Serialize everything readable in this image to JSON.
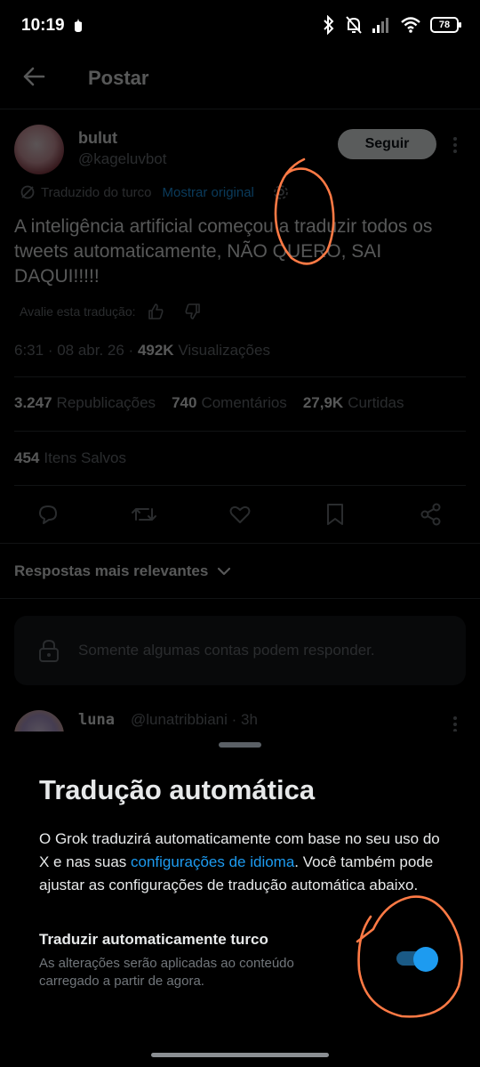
{
  "status_bar": {
    "time": "10:19",
    "battery": "78",
    "icons": [
      "notification-dot-icon",
      "bluetooth-icon",
      "mute-icon",
      "signal-icon",
      "wifi-icon",
      "battery-icon"
    ]
  },
  "header": {
    "title": "Postar",
    "back_icon": "arrow-left-icon"
  },
  "post": {
    "author_name": "bulut",
    "author_handle": "@kageluvbot",
    "follow_label": "Seguir",
    "translated_label": "Traduzido do turco",
    "show_original_label": "Mostrar original",
    "text": "A inteligência artificial começou a traduzir todos os tweets automaticamente, NÃO QUERO, SAI DAQUI!!!!!",
    "rate_label": "Avalie esta tradução:",
    "time": "6:31",
    "date": "08 abr. 26",
    "views_count": "492K",
    "views_label": "Visualizações",
    "stats": [
      {
        "count": "3.247",
        "label": "Republicações"
      },
      {
        "count": "740",
        "label": "Comentários"
      },
      {
        "count": "27,9K",
        "label": "Curtidas"
      }
    ],
    "saved_count": "454",
    "saved_label": "Itens Salvos"
  },
  "sort_label": "Respostas mais relevantes",
  "restricted_notice": "Somente algumas contas podem responder.",
  "reply": {
    "name": "luna",
    "handle": "@lunatribbiani",
    "age": "3h"
  },
  "sheet": {
    "title": "Tradução automática",
    "desc_before": "O Grok traduzirá automaticamente com base no seu uso do X e nas suas ",
    "desc_link": "configurações de idioma",
    "desc_after": ". Você também pode ajustar as configurações de tradução automática abaixo.",
    "option_title": "Traduzir automaticamente turco",
    "option_desc": "As alterações serão aplicadas ao conteúdo carregado a partir de agora.",
    "toggle_on": true
  },
  "colors": {
    "accent": "#1d9bf0",
    "background": "#000000",
    "secondary_text": "#71767b",
    "annotation": "#ff7a45"
  }
}
